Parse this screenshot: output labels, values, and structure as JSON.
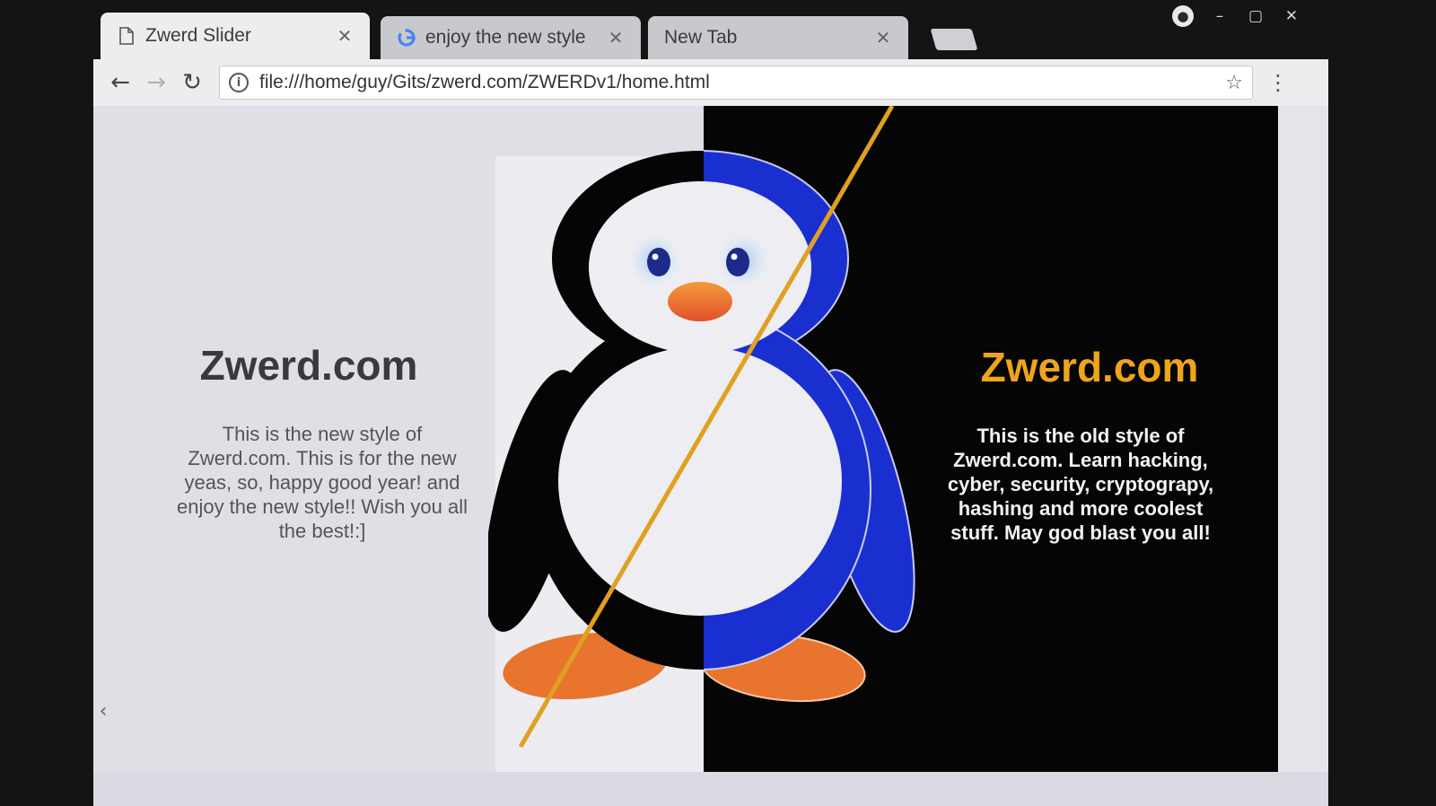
{
  "window": {
    "controls": {
      "user_icon": "user-icon",
      "minimize": "–",
      "maximize": "▢",
      "close": "✕"
    }
  },
  "tabs": [
    {
      "title": "Zwerd Slider",
      "icon": "page-icon",
      "close": "✕",
      "active": true
    },
    {
      "title": "enjoy the new style",
      "icon": "google-icon",
      "close": "✕",
      "active": false
    },
    {
      "title": "New Tab",
      "icon": "",
      "close": "✕",
      "active": false
    }
  ],
  "toolbar": {
    "back": "←",
    "forward": "→",
    "reload": "↻",
    "url": "file:///home/guy/Gits/zwerd.com/ZWERDv1/home.html",
    "info": "i",
    "star": "☆",
    "menu": "⋮"
  },
  "page": {
    "new_style": {
      "title": "Zwerd.com",
      "text": "This is the new style of Zwerd.com. This is for the new yeas, so, happy good year! and enjoy the new style!! Wish you all the best!:]"
    },
    "old_style": {
      "title": "Zwerd.com",
      "text": "This is the old style of Zwerd.com. Learn hacking, cyber, security, cryptograpy, hashing and more coolest stuff. May god blast you all!"
    },
    "slider_handle": "‹"
  },
  "colors": {
    "accent_old": "#f0a41b",
    "divider_line": "#e0a020",
    "penguin_blue": "#1a2fd0",
    "feet_orange": "#e8742e"
  }
}
